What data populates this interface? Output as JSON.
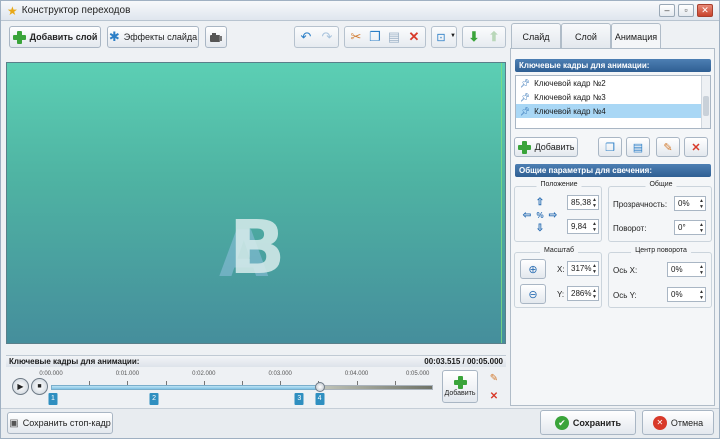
{
  "window": {
    "title": "Конструктор переходов"
  },
  "toolbar": {
    "add_layer": "Добавить слой",
    "slide_effects": "Эффекты слайда"
  },
  "tabs": [
    {
      "label": "Слайд"
    },
    {
      "label": "Слой"
    },
    {
      "label": "Анимация"
    }
  ],
  "keyframes_panel": {
    "heading": "Ключевые кадры для анимации:",
    "items": [
      {
        "label": "Ключевой кадр №2"
      },
      {
        "label": "Ключевой кадр №3"
      },
      {
        "label": "Ключевой кадр №4"
      }
    ],
    "add_button": "Добавить"
  },
  "params": {
    "heading": "Общие параметры для свечения:",
    "position_label": "Положение",
    "position_x": "85,38",
    "position_y": "9,84",
    "general_label": "Общие",
    "opacity_label": "Прозрачность:",
    "opacity_value": "0%",
    "rotation_label": "Поворот:",
    "rotation_value": "0°",
    "scale_label": "Масштаб",
    "scale_x_label": "X:",
    "scale_x_value": "317%",
    "scale_y_label": "Y:",
    "scale_y_value": "286%",
    "pivot_label": "Центр поворота",
    "pivot_x_label": "Ось X:",
    "pivot_x_value": "0%",
    "pivot_y_label": "Ось Y:",
    "pivot_y_value": "0%"
  },
  "canvas": {
    "letter_front": "B",
    "letter_back": "A"
  },
  "timeline": {
    "heading": "Ключевые кадры для анимации:",
    "time": "00:03.515 / 00:05.000",
    "ticks": [
      "0:00.000",
      "0:01.000",
      "0:02.000",
      "0:03.000",
      "0:04.000",
      "0:05.000"
    ],
    "keyframes": [
      "1",
      "2",
      "3",
      "4"
    ],
    "add_label": "Добавить"
  },
  "footer": {
    "save_frame": "Сохранить стоп-кадр",
    "save": "Сохранить",
    "cancel": "Отмена"
  }
}
